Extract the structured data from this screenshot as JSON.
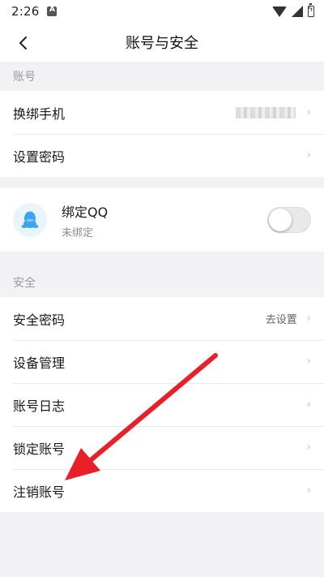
{
  "status_bar": {
    "time": "2:26",
    "notification_icon": "android-notification-icon",
    "icons": [
      "wifi-icon",
      "signal-icon",
      "battery-charging-icon"
    ]
  },
  "header": {
    "title": "账号与安全",
    "back_icon": "chevron-left-icon"
  },
  "account_section": {
    "label": "账号",
    "items": [
      {
        "label": "换绑手机",
        "value_masked": true
      },
      {
        "label": "设置密码"
      }
    ]
  },
  "qq_binding": {
    "title": "绑定QQ",
    "subtitle": "未绑定",
    "toggle_on": false,
    "avatar_icon": "qq-penguin-icon"
  },
  "security_section": {
    "label": "安全",
    "items": [
      {
        "label": "安全密码",
        "value": "去设置"
      },
      {
        "label": "设备管理"
      },
      {
        "label": "账号日志"
      },
      {
        "label": "锁定账号"
      },
      {
        "label": "注销账号"
      }
    ]
  },
  "chevron_glyph": "›",
  "colors": {
    "background": "#f2f2f4",
    "card": "#ffffff",
    "section_label": "#9a9aa0",
    "annotation_arrow": "#e8202a",
    "qq_blue": "#3aa6f2"
  }
}
